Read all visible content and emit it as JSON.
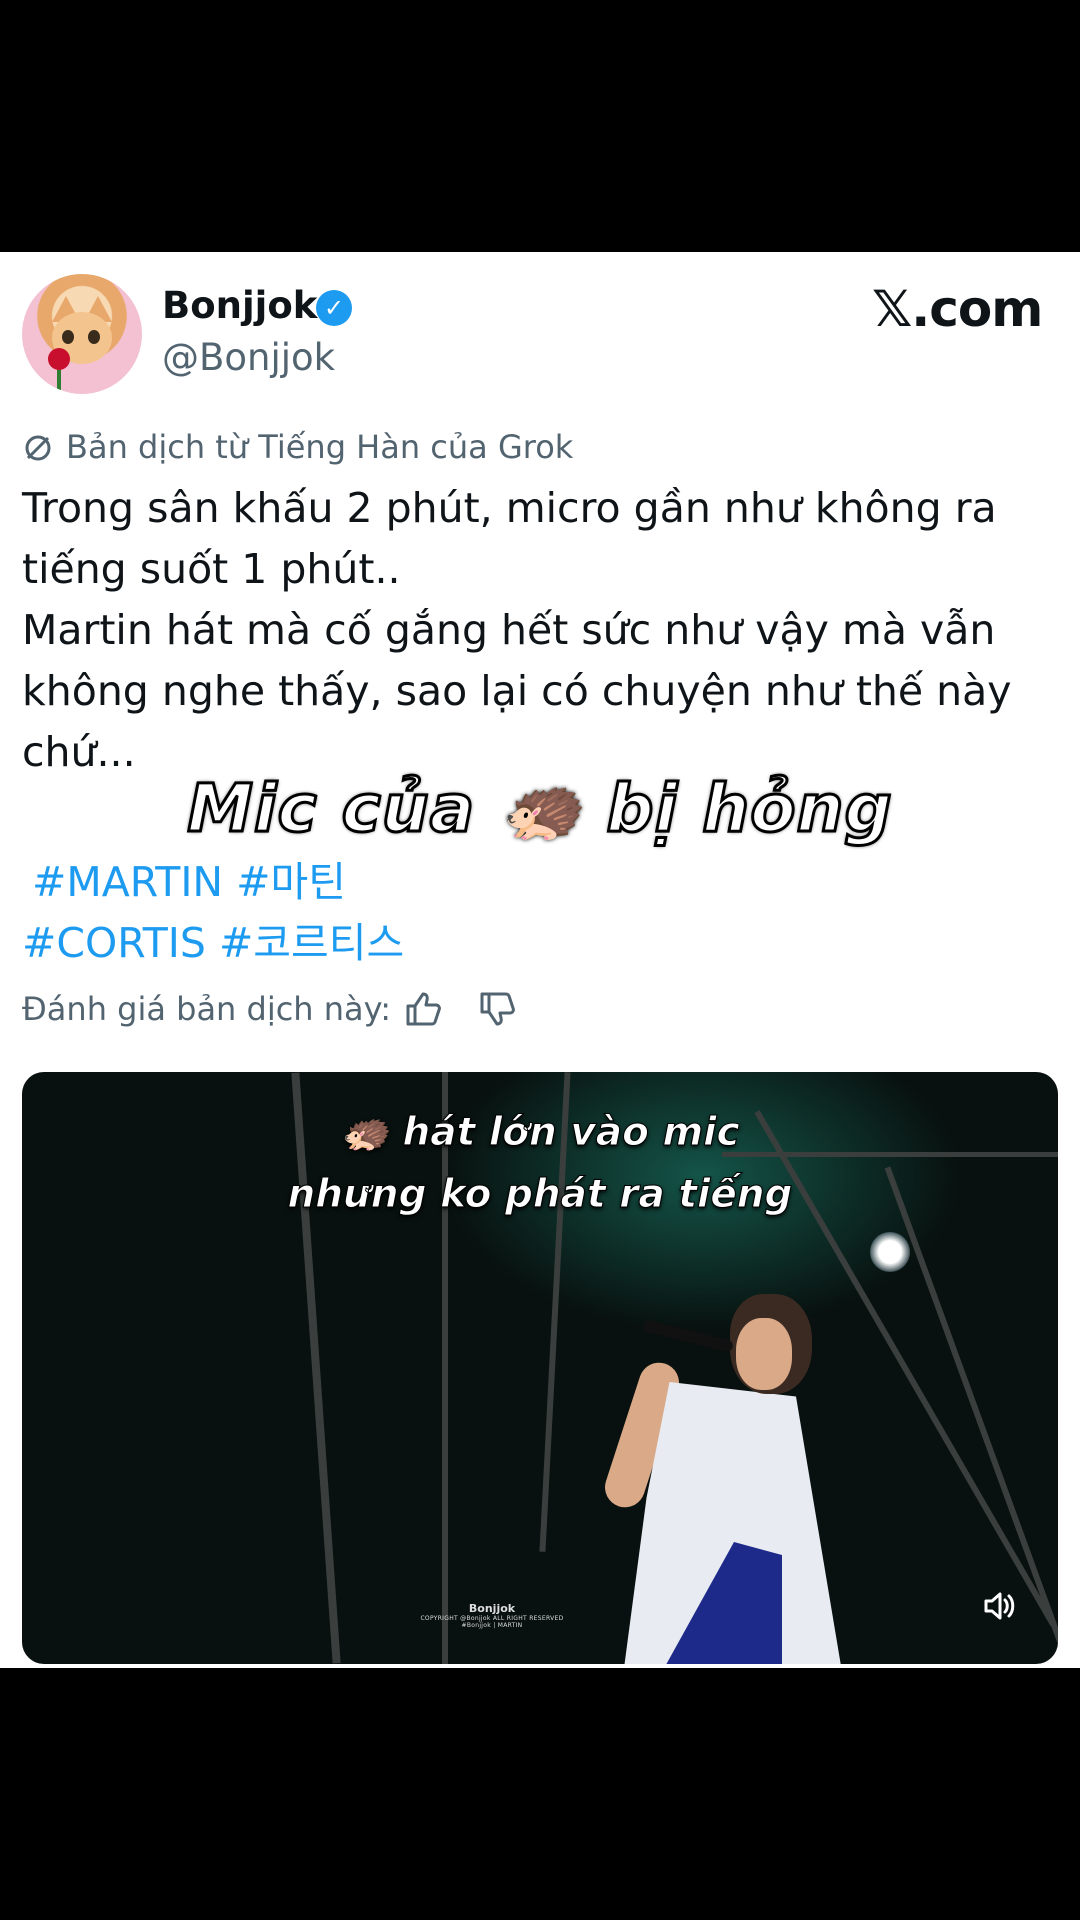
{
  "post": {
    "author_name": "Bonjjok",
    "author_handle": "@Bonjjok",
    "site_label": "𝕏.com",
    "translation_note": "Bản dịch từ Tiếng Hàn của Grok",
    "text_lines": [
      "Trong sân khấu 2 phút, micro gần như không ra tiếng suốt 1 phút..",
      "Martin hát mà cố gắng hết sức như vậy mà vẫn không nghe thấy, sao lại có chuyện như thế này chứ..."
    ],
    "hashtags": [
      "#MARTIN #마틴",
      "#CORTIS #코르티스"
    ],
    "rate_label": "Đánh giá bản dịch này:"
  },
  "overlay": {
    "title": "Mic của 🦔 bị hỏng"
  },
  "video": {
    "caption_line1": "🦔 hát lớn vào mic",
    "caption_line2": "nhưng ko phát ra tiếng",
    "watermark_name": "Bonjjok",
    "watermark_copyright": "COPYRIGHT @Bonjjok ALL RIGHT RESERVED",
    "watermark_tag": "#Bonjjok | MARTIN"
  },
  "icons": {
    "verified": "verified-badge-icon",
    "translate": "translate-icon",
    "thumbs_up": "thumbs-up-icon",
    "thumbs_down": "thumbs-down-icon",
    "sound": "volume-icon"
  },
  "colors": {
    "link": "#1d9bf0",
    "muted": "#536471",
    "text": "#0f1419"
  }
}
